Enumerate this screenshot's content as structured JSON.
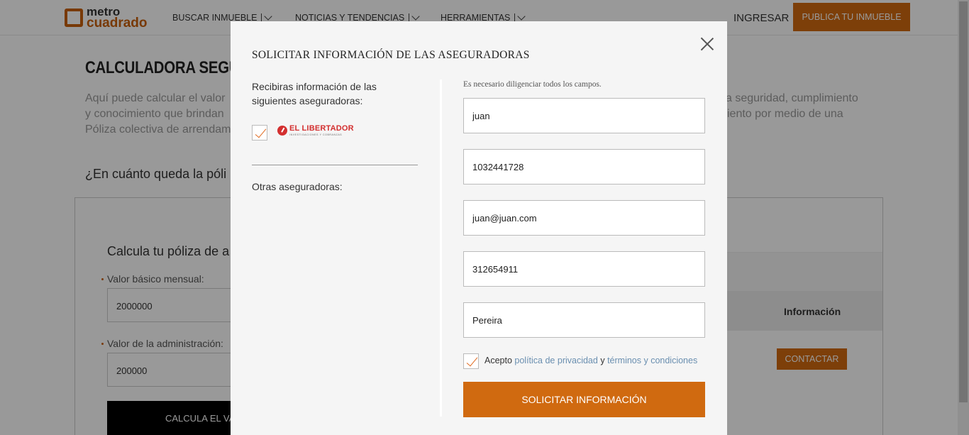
{
  "header": {
    "logo_line1": "metro",
    "logo_line2": "cuadrado",
    "nav": [
      "BUSCAR INMUEBLE",
      "NOTICIAS Y TENDENCIAS",
      "HERRAMIENTAS"
    ],
    "login": "INGRESAR",
    "publish": "PUBLICA TU INMUEBLE"
  },
  "page": {
    "title": "CALCULADORA SEGURO",
    "para_left": [
      "Aquí puede calcular el valor",
      "y conocimiento que brindan",
      "Póliza colectiva de arrendam"
    ],
    "para_right": [
      "a seguridad, cumplimiento",
      "iento por medio de una"
    ],
    "question": "¿En cuánto queda la póli",
    "calc_title": "Calcula tu póliza de a",
    "label_basic": "Valor básico mensual:",
    "value_basic": "2000000",
    "label_admin": "Valor de la administración:",
    "value_admin": "200000",
    "calc_button": "CALCULA EL VA",
    "table_info": "Información",
    "contact_button": "CONTACTAR"
  },
  "modal": {
    "title": "SOLICITAR INFORMACIÓN DE LAS ASEGURADORAS",
    "receive_text": "Recibiras información de las siguientes aseguradoras:",
    "insurer_name": "EL LIBERTADOR",
    "insurer_tagline": "INVESTIGACIONES Y COBRANZAS",
    "others_label": "Otras aseguradoras:",
    "required_note": "Es necesario diligenciar todos los campos.",
    "fields": {
      "name": "juan",
      "id_number": "1032441728",
      "email": "juan@juan.com",
      "phone": "312654911",
      "city": "Pereira"
    },
    "accept_prefix": "Acepto",
    "privacy_link": "política de privacidad",
    "and_word": "y",
    "terms_link": "términos y condiciones",
    "submit": "SOLICITAR INFORMACIÓN"
  },
  "colors": {
    "accent": "#d06a10",
    "link": "#6a8fb0",
    "insurer_red": "#d32f2f"
  }
}
